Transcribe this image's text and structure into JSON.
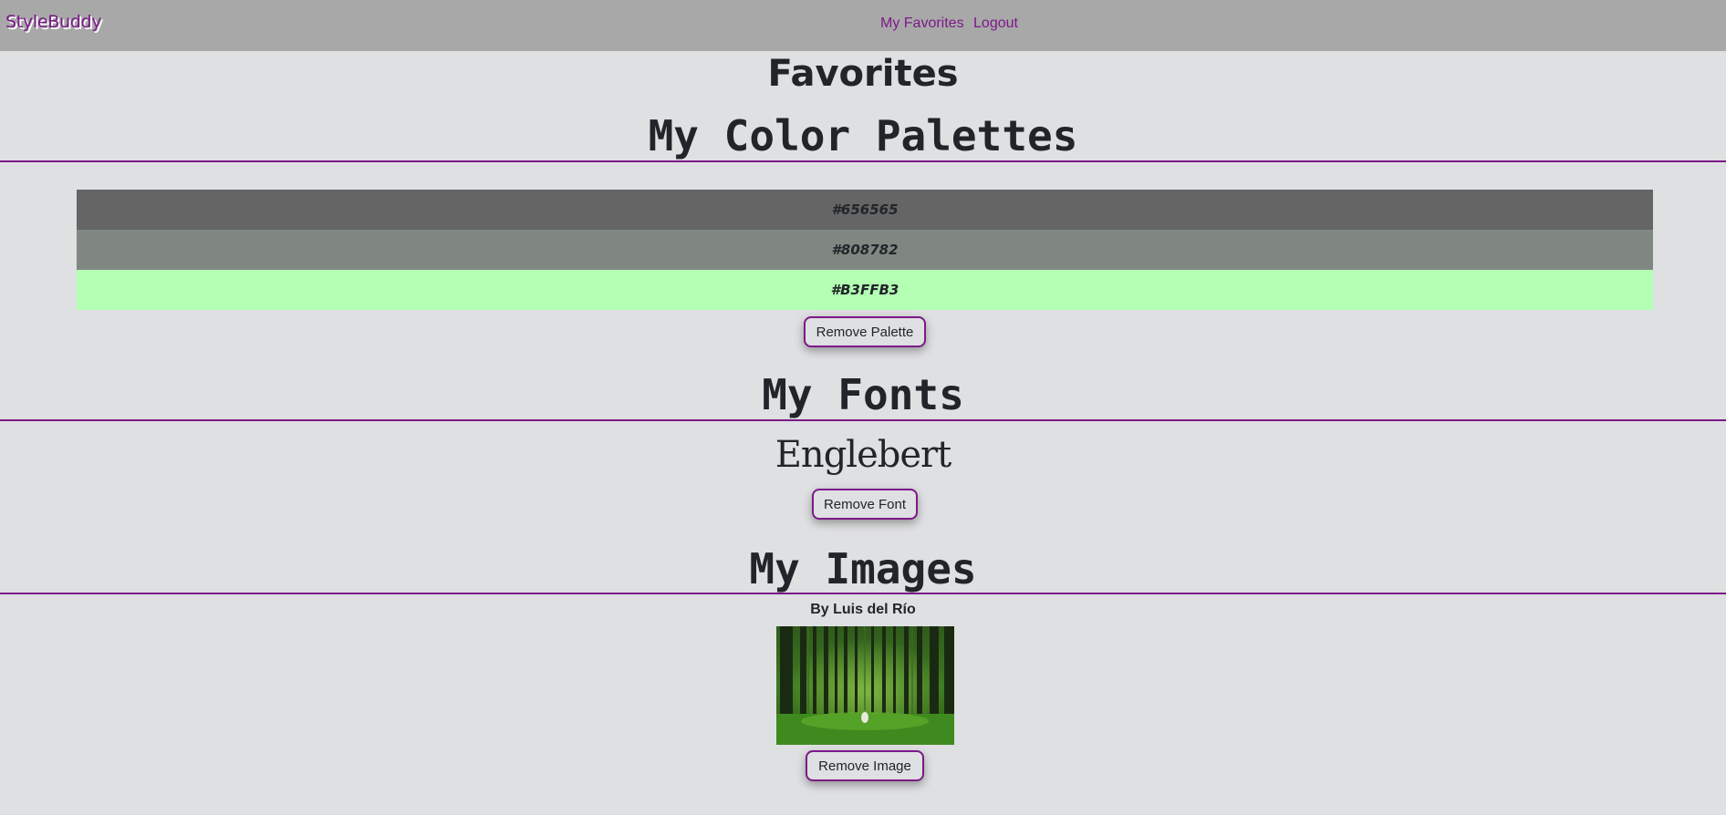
{
  "navbar": {
    "brand": "StyleBuddy",
    "links": [
      "My Favorites",
      "Logout"
    ]
  },
  "page": {
    "title": "Favorites"
  },
  "palettes": {
    "heading": "My Color Palettes",
    "colors": [
      "#656565",
      "#808782",
      "#B3FFB3"
    ],
    "remove_label": "Remove Palette"
  },
  "fonts": {
    "heading": "My Fonts",
    "items": [
      "Englebert"
    ],
    "remove_label": "Remove Font"
  },
  "images": {
    "heading": "My Images",
    "credit": "By Luis del Río",
    "remove_label": "Remove Image"
  },
  "theme": {
    "accent": "#7b1a88",
    "navbar_bg": "#a8a8a8",
    "page_bg": "#dfe0e2"
  }
}
